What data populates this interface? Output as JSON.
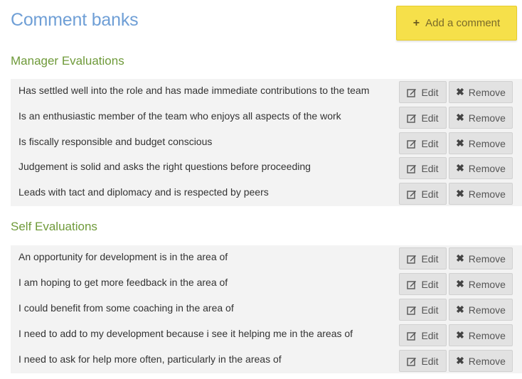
{
  "header": {
    "title": "Comment banks",
    "add_button_label": "Add a comment",
    "add_button_icon": "plus-icon",
    "accent_color": "#f6e04a"
  },
  "actions": {
    "edit_label": "Edit",
    "remove_label": "Remove",
    "edit_icon": "pencil-square-icon",
    "remove_icon": "close-x-icon"
  },
  "sections": [
    {
      "title": "Manager Evaluations",
      "items": [
        "Has settled well into the role and has made immediate contributions to the team",
        "Is an enthusiastic member of the team who enjoys all aspects of the work",
        "Is fiscally responsible and budget conscious",
        "Judgement is solid and asks the right questions before proceeding",
        "Leads with tact and diplomacy and is respected by peers"
      ]
    },
    {
      "title": "Self Evaluations",
      "items": [
        "An opportunity for development is in the area of",
        "I am hoping to get more feedback in the area of",
        "I could benefit from some coaching in the area of",
        "I need to add to my development because i see it helping me in the areas of",
        "I need to ask for help more often, particularly in the areas of"
      ]
    }
  ]
}
